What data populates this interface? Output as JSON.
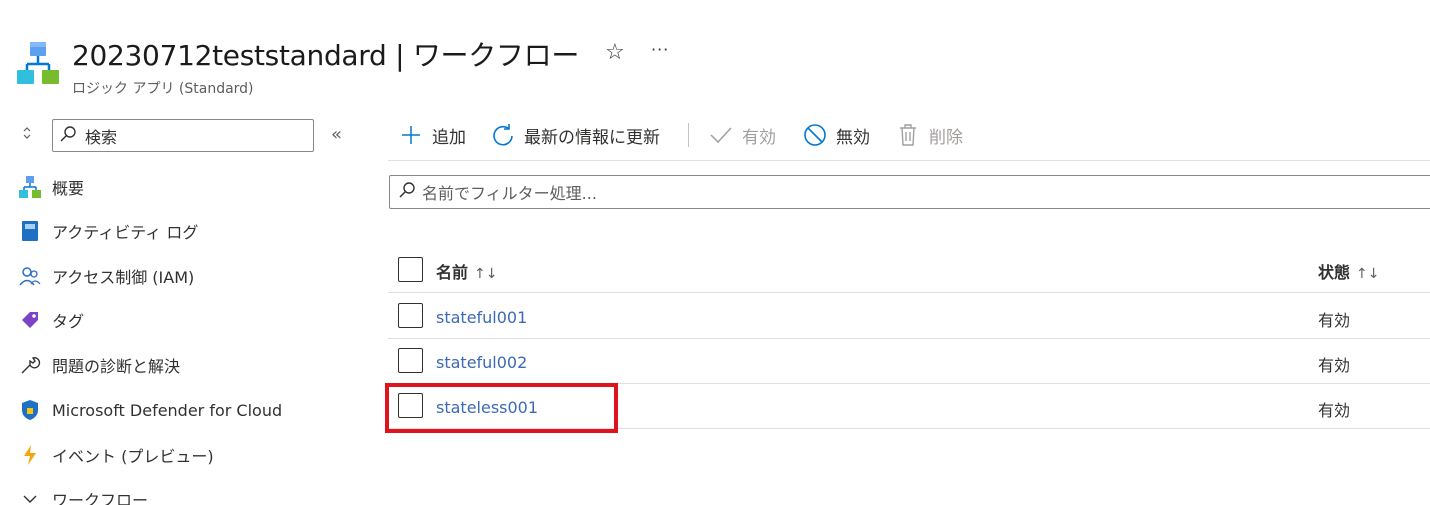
{
  "header": {
    "title": "20230712teststandard | ワークフロー",
    "subtitle": "ロジック アプリ (Standard)",
    "favorite_icon": "star-icon",
    "more_icon": "ellipsis-icon"
  },
  "sidebar": {
    "search_placeholder": "検索",
    "items": [
      {
        "label": "概要",
        "icon": "logic-app-icon"
      },
      {
        "label": "アクティビティ ログ",
        "icon": "activity-log-icon"
      },
      {
        "label": "アクセス制御 (IAM)",
        "icon": "people-icon"
      },
      {
        "label": "タグ",
        "icon": "tag-icon"
      },
      {
        "label": "問題の診断と解決",
        "icon": "wrench-icon"
      },
      {
        "label": "Microsoft Defender for Cloud",
        "icon": "shield-icon"
      },
      {
        "label": "イベント (プレビュー)",
        "icon": "lightning-icon"
      },
      {
        "label": "ワークフロー",
        "icon": "chevron-down-icon"
      }
    ]
  },
  "toolbar": {
    "add": "追加",
    "refresh": "最新の情報に更新",
    "enable": "有効",
    "disable": "無効",
    "delete": "削除"
  },
  "filter": {
    "placeholder": "名前でフィルター処理..."
  },
  "table": {
    "columns": {
      "name": "名前",
      "state": "状態"
    },
    "sort_name": "↑↓",
    "sort_state": "↑↓",
    "rows": [
      {
        "name": "stateful001",
        "state": "有効"
      },
      {
        "name": "stateful002",
        "state": "有効"
      },
      {
        "name": "stateless001",
        "state": "有効"
      }
    ]
  },
  "colors": {
    "accent": "#0078d4",
    "link": "#3d6ab3",
    "highlight": "#e0121d"
  }
}
